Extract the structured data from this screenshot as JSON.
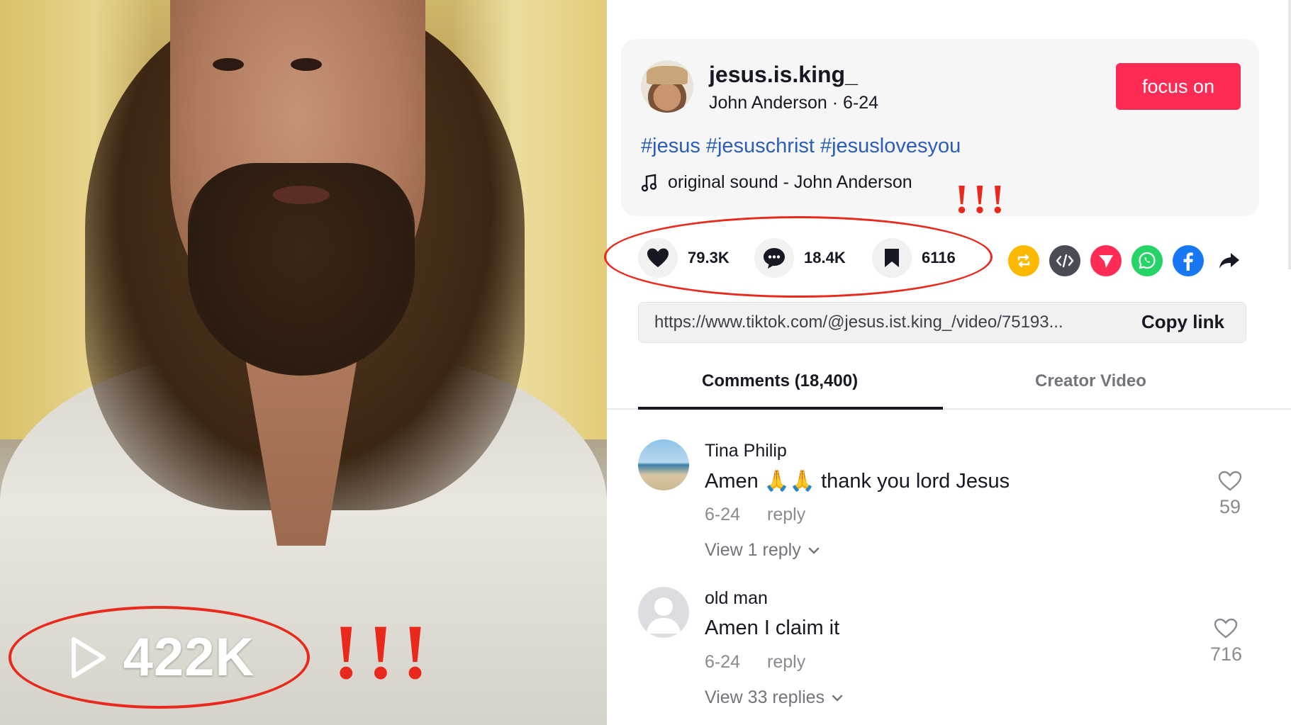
{
  "video": {
    "view_count": "422K",
    "annotation_marks": "!!!"
  },
  "author": {
    "username": "jesus.is.king_",
    "display_name": "John Anderson",
    "date": "6-24",
    "follow_label": "focus on"
  },
  "caption": {
    "hashtags": [
      "#jesus",
      "#jesuschrist",
      "#jesuslovesyou"
    ],
    "sound": "original sound - John Anderson"
  },
  "annotation_marks_small": "!!!",
  "stats": {
    "likes": "79.3K",
    "comments": "18.4K",
    "saves": "6116"
  },
  "share_icons": [
    "repost-icon",
    "embed-icon",
    "send-to-friends-icon",
    "whatsapp-icon",
    "facebook-icon",
    "share-arrow-icon"
  ],
  "link": {
    "url": "https://www.tiktok.com/@jesus.ist.king_/video/75193...",
    "copy_label": "Copy link"
  },
  "tabs": [
    {
      "label": "Comments (18,400)",
      "active": true
    },
    {
      "label": "Creator Video",
      "active": false
    }
  ],
  "comments": [
    {
      "name": "Tina Philip",
      "text": "Amen 🙏🙏 thank you lord Jesus",
      "date": "6-24",
      "reply_label": "reply",
      "view_replies": "View 1 reply",
      "likes": "59"
    },
    {
      "name": "old man",
      "text": "Amen I claim it",
      "date": "6-24",
      "reply_label": "reply",
      "view_replies": "View 33 replies",
      "likes": "716"
    }
  ],
  "colors": {
    "accent": "#fe2c55",
    "hashtag": "#2b5db9",
    "annotation": "#e8291c"
  }
}
